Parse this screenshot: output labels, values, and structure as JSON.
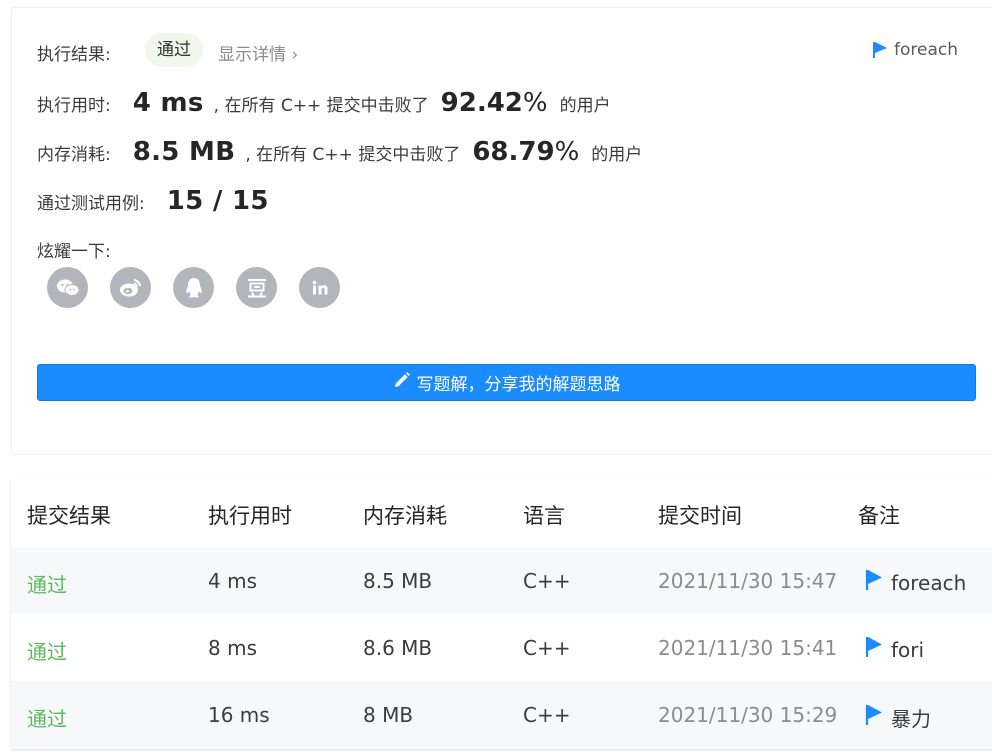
{
  "result": {
    "label": "执行结果:",
    "status": "通过",
    "details_link": "显示详情",
    "details_chevron": "›",
    "note": "foreach",
    "runtime": {
      "label": "执行用时:",
      "value": "4 ms",
      "prefix": ", 在所有 C++ 提交中击败了",
      "percent": "92.42",
      "percent_sym": "%",
      "suffix": "的用户"
    },
    "memory": {
      "label": "内存消耗:",
      "value": "8.5 MB",
      "prefix": ", 在所有 C++ 提交中击败了",
      "percent": "68.79",
      "percent_sym": "%",
      "suffix": "的用户"
    },
    "testcases": {
      "label": "通过测试用例:",
      "value": "15 / 15"
    },
    "share": {
      "label": "炫耀一下:",
      "icons": [
        "wechat-icon",
        "weibo-icon",
        "qq-icon",
        "douban-icon",
        "linkedin-icon"
      ]
    },
    "write_button": "写题解，分享我的解题思路",
    "colors": {
      "accent": "#1a8cff",
      "status_green": "#5cb85c",
      "flag_blue": "#1a8cff"
    }
  },
  "submissions": {
    "headers": [
      "提交结果",
      "执行用时",
      "内存消耗",
      "语言",
      "提交时间",
      "备注"
    ],
    "rows": [
      {
        "status": "通过",
        "runtime": "4 ms",
        "memory": "8.5 MB",
        "lang": "C++",
        "time": "2021/11/30 15:47",
        "note": "foreach"
      },
      {
        "status": "通过",
        "runtime": "8 ms",
        "memory": "8.6 MB",
        "lang": "C++",
        "time": "2021/11/30 15:41",
        "note": "fori"
      },
      {
        "status": "通过",
        "runtime": "16 ms",
        "memory": "8 MB",
        "lang": "C++",
        "time": "2021/11/30 15:29",
        "note": "暴力"
      }
    ]
  }
}
